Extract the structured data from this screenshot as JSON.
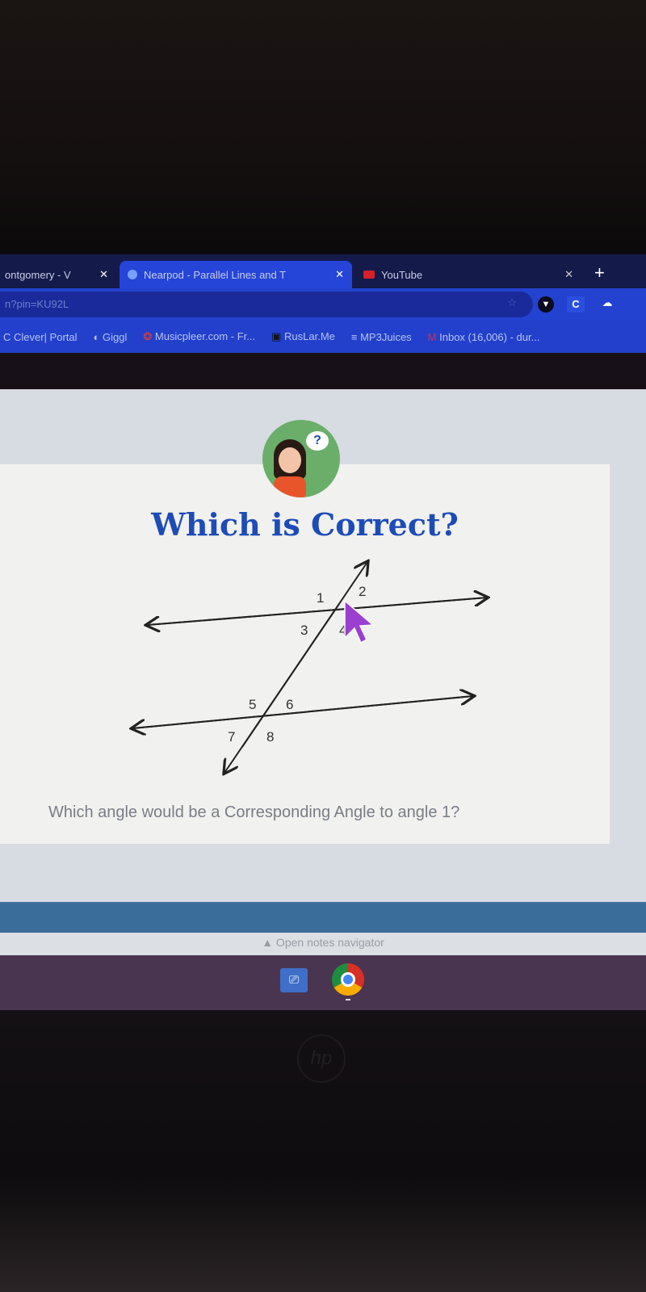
{
  "browser": {
    "tabs": [
      {
        "label": "ontgomery - V",
        "close": "✕"
      },
      {
        "label": "Nearpod - Parallel Lines and T",
        "close": "✕"
      },
      {
        "label": "YouTube",
        "close": "✕"
      }
    ],
    "new_tab": "+",
    "url": "n?pin=KU92L",
    "bookmarks": [
      "Clever| Portal",
      "Giggl",
      "Musicpleer.com - Fr...",
      "RusLar.Me",
      "MP3Juices",
      "Inbox (16,006) - dur..."
    ],
    "colors": {
      "accent": "#2445d8"
    }
  },
  "slide": {
    "title": "Which is Correct?",
    "avatar_bubble": "?",
    "angle_labels": [
      "1",
      "2",
      "3",
      "4",
      "5",
      "6",
      "7",
      "8"
    ],
    "question": "Which angle would be a Corresponding Angle to angle 1?"
  },
  "footer": {
    "notes": "▲ Open notes navigator"
  },
  "laptop": {
    "logo": "hp"
  }
}
